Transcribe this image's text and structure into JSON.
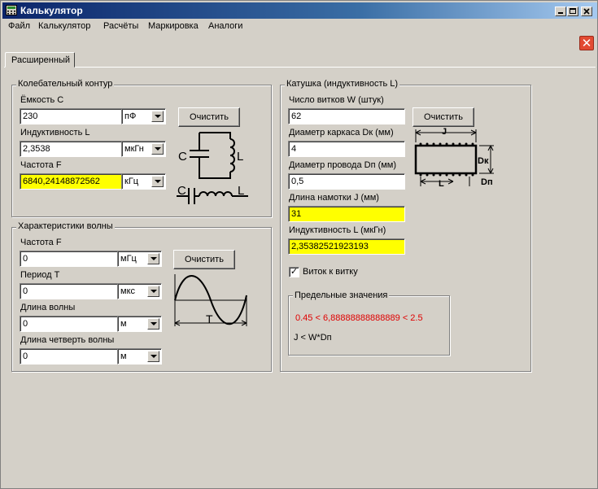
{
  "window": {
    "title": "Калькулятор"
  },
  "menu": [
    "Файл",
    "Калькулятор",
    "Расчёты",
    "Маркировка",
    "Аналоги"
  ],
  "tab": {
    "label": "Расширенный"
  },
  "oscillator": {
    "legend": "Колебательный контур",
    "capacitance": {
      "label": "Ёмкость C",
      "value": "230",
      "unit": "пФ"
    },
    "inductance": {
      "label": "Индуктивность L",
      "value": "2,3538",
      "unit": "мкГн"
    },
    "frequency": {
      "label": "Частота F",
      "value": "6840,24148872562",
      "unit": "кГц"
    },
    "clear_label": "Очистить",
    "diagram": {
      "c_label": "C",
      "l_label": "L",
      "c_label2": "C",
      "l_label2": "L"
    }
  },
  "wave": {
    "legend": "Характеристики волны",
    "frequency": {
      "label": "Частота F",
      "value": "0",
      "unit": "мГц"
    },
    "period": {
      "label": "Период T",
      "value": "0",
      "unit": "мкс"
    },
    "wavelength": {
      "label": "Длина волны",
      "value": "0",
      "unit": "м"
    },
    "quarter": {
      "label": "Длина четверть волны",
      "value": "0",
      "unit": "м"
    },
    "clear_label": "Очистить",
    "diagram": {
      "t_label": "T"
    }
  },
  "coil": {
    "legend": "Катушка (индуктивность L)",
    "turns": {
      "label": "Число витков W (штук)",
      "value": "62"
    },
    "frame_diameter": {
      "label": "Диаметр каркаса Dк (мм)",
      "value": "4"
    },
    "wire_diameter": {
      "label": "Диаметр провода Dп (мм)",
      "value": "0,5"
    },
    "winding_length": {
      "label": "Длина намотки J (мм)",
      "value": "31"
    },
    "inductance": {
      "label": "Индуктивность L (мкГн)",
      "value": "2,35382521923193"
    },
    "clear_label": "Очистить",
    "turn_to_turn": {
      "label": "Виток к витку",
      "checked": true,
      "mark": "✓"
    },
    "diagram": {
      "j_label": "J",
      "dk_label": "Dк",
      "l_label": "L",
      "dp_label": "Dп"
    },
    "limits": {
      "legend": "Предельные значения",
      "line1": "0.45 < 6,88888888888889 < 2.5",
      "line2": "J < W*Dп"
    }
  },
  "colors": {
    "highlight": "#ffff00",
    "warning_text": "#e00000",
    "titlebar": "#0a246a"
  }
}
